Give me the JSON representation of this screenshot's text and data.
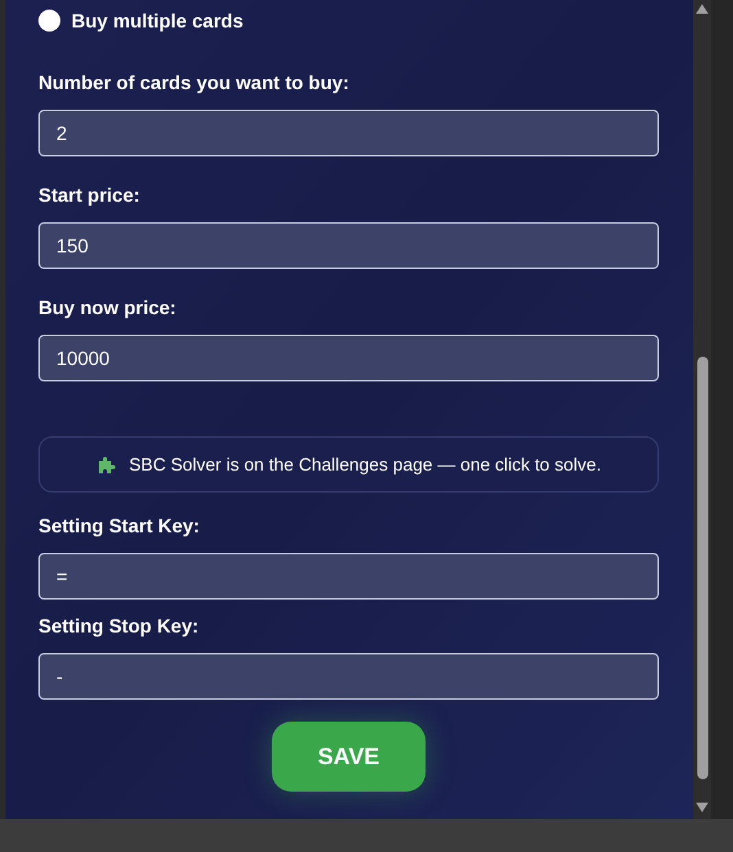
{
  "buy_multiple": {
    "label": "Buy multiple cards",
    "selected": false
  },
  "fields_top": [
    {
      "label": "Number of cards you want to buy:",
      "value": "2"
    },
    {
      "label": "Start price:",
      "value": "150"
    },
    {
      "label": "Buy now price:",
      "value": "10000"
    }
  ],
  "notice": "SBC Solver is on the Challenges page — one click to solve.",
  "fields_keys": [
    {
      "label": "Setting Start Key:",
      "value": "="
    },
    {
      "label": "Setting Stop Key:",
      "value": "-"
    }
  ],
  "save_button": "SAVE"
}
